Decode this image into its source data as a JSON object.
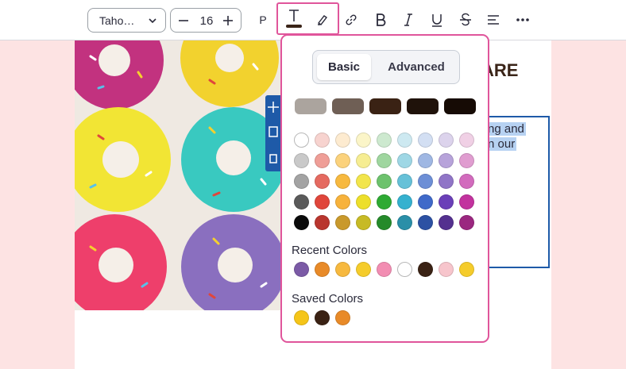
{
  "toolbar": {
    "font_family": "Taho…",
    "font_size": "16",
    "paragraph_label": "P",
    "icons": [
      "chevron-down-icon",
      "minus-icon",
      "plus-icon",
      "text-color-icon",
      "highlight-icon",
      "link-icon",
      "bold-icon",
      "italic-icon",
      "underline-icon",
      "strikethrough-icon",
      "align-icon",
      "more-icon"
    ],
    "text_color": "#3a2418"
  },
  "canvas": {
    "heading_fragment": "ARE",
    "selected_text_lines": [
      "ng and",
      "n our"
    ]
  },
  "color_picker": {
    "tabs": [
      "Basic",
      "Advanced"
    ],
    "active_tab": "Basic",
    "theme_colors": [
      "#aba49e",
      "#6f5f55",
      "#3a2214",
      "#1f120a",
      "#160b05"
    ],
    "palette_rows": [
      [
        "#ffffff",
        "#f7d3cf",
        "#fdebd0",
        "#fbf5c8",
        "#cde9cf",
        "#cde9f1",
        "#d3dff3",
        "#dcd3ec",
        "#f0d0e5"
      ],
      [
        "#c9c9c9",
        "#ef9e97",
        "#fbd27c",
        "#f6ed92",
        "#9fd69f",
        "#9ed7e5",
        "#9fb7e3",
        "#b7a3da",
        "#e09dd0"
      ],
      [
        "#a3a3a3",
        "#e56a60",
        "#f7b93f",
        "#f2e54b",
        "#6dc26d",
        "#66c1d8",
        "#6d8fd6",
        "#9075c7",
        "#d26bbd"
      ],
      [
        "#5a5a5a",
        "#e0463b",
        "#f7b23b",
        "#eddf2a",
        "#2eaa33",
        "#35b1cf",
        "#3f69c9",
        "#6a3fb8",
        "#c2329e"
      ],
      [
        "#0a0a0a",
        "#b9362e",
        "#c9992c",
        "#c7ba25",
        "#258a2a",
        "#2a8fa8",
        "#2c51a3",
        "#54308f",
        "#9b2780"
      ]
    ],
    "recent_label": "Recent Colors",
    "recent_colors": [
      "#7b5aa6",
      "#e88a28",
      "#f7b93f",
      "#f5cc2b",
      "#f28db2",
      "#ffffff",
      "#3a2214",
      "#f7c5cc",
      "#f5cc2b"
    ],
    "saved_label": "Saved Colors",
    "saved_colors": [
      "#f5c518",
      "#3a2214",
      "#e88a28"
    ]
  },
  "colors": {
    "accent_pink": "#e0559b",
    "selection_blue": "#1e5aa8",
    "page_background": "#fde3e3"
  }
}
